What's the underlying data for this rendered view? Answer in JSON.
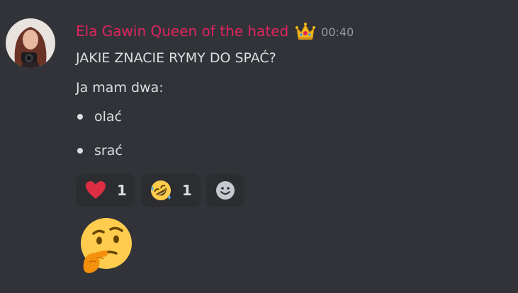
{
  "message": {
    "author": "Ela Gawin Queen of the hated",
    "author_color": "#e0245e",
    "role_icon": "crown-icon",
    "timestamp": "00:40",
    "lines": [
      "JAKIE ZNACIE RYMY DO SPAĆ?",
      "Ja mam dwa:"
    ],
    "bullets": [
      "olać",
      "srać"
    ],
    "reactions": [
      {
        "emoji": "red-heart-icon",
        "count": "1"
      },
      {
        "emoji": "rolling-on-floor-laughing-icon",
        "count": "1"
      }
    ],
    "add_reaction_icon": "add-reaction-smiley-icon",
    "big_emoji": "thinking-face-icon"
  },
  "colors": {
    "background": "#313338",
    "text": "#dbdee1",
    "muted": "#949ba4",
    "reaction_bg": "#2b2d31"
  }
}
